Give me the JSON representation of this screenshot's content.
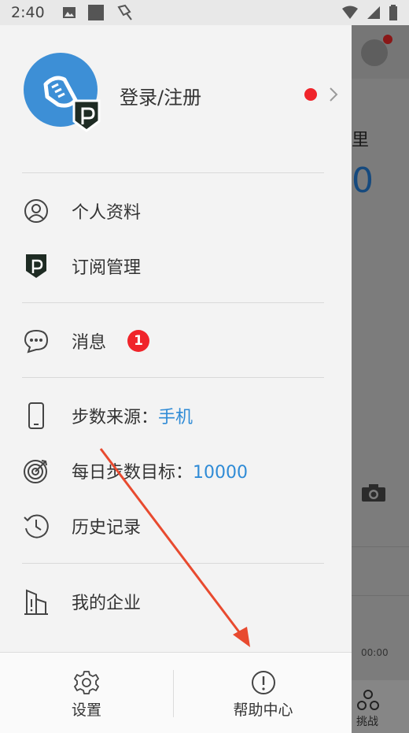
{
  "status_bar": {
    "time": "2:40"
  },
  "background_app": {
    "partial_text": "里",
    "partial_number": "0",
    "time_label": "00:00",
    "tab_label": "挑战"
  },
  "profile": {
    "login_label": "登录/注册"
  },
  "menu": {
    "personal_info": "个人资料",
    "subscription": "订阅管理",
    "messages": "消息",
    "messages_badge": "1",
    "step_source_label": "步数来源：",
    "step_source_value": "手机",
    "daily_goal_label": "每日步数目标：",
    "daily_goal_value": "10000",
    "history": "历史记录",
    "enterprise": "我的企业"
  },
  "bottom_bar": {
    "settings": "设置",
    "help": "帮助中心"
  },
  "colors": {
    "accent": "#2f8bd6",
    "badge_red": "#f0242a",
    "arrow_red": "#e84a2f",
    "avatar_blue": "#3d8fd6"
  }
}
